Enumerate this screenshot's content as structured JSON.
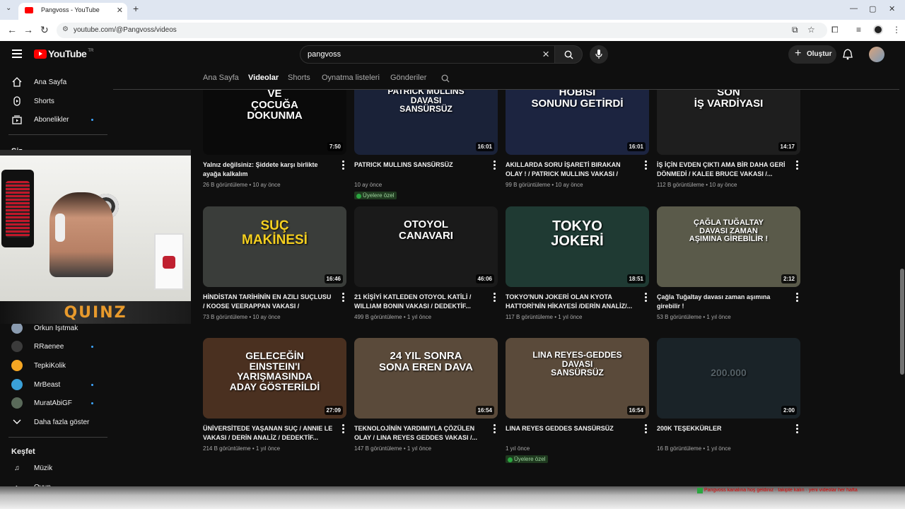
{
  "browser": {
    "tab_title": "Pangvoss - YouTube",
    "tab_close": "✕",
    "new_tab": "+",
    "url": "youtube.com/@Pangvoss/videos"
  },
  "youtube": {
    "logo_text": "YouTube",
    "logo_region": "TR",
    "search_value": "pangvoss",
    "create_label": "Oluştur"
  },
  "sidebar": {
    "top_items": [
      {
        "label": "Ana Sayfa",
        "icon": "home-icon"
      },
      {
        "label": "Shorts",
        "icon": "shorts-icon"
      },
      {
        "label": "Abonelikler",
        "icon": "subscriptions-icon"
      }
    ],
    "you_heading": "Siz",
    "subscriptions": [
      {
        "label": "Orkun Işıtmak",
        "color": "#8a9bb0"
      },
      {
        "label": "RRaenee",
        "color": "#3b3b3b"
      },
      {
        "label": "TepkiKolik",
        "color": "#f5a623"
      },
      {
        "label": "MrBeast",
        "color": "#3aa0d8"
      },
      {
        "label": "MuratAbiGF",
        "color": "#5a6a5a"
      }
    ],
    "show_more": "Daha fazla göster",
    "explore_heading": "Keşfet",
    "explore_items": [
      {
        "label": "Müzik"
      },
      {
        "label": "Oyun"
      }
    ]
  },
  "channel_tabs": [
    "Ana Sayfa",
    "Videolar",
    "Shorts",
    "Oynatma listeleri",
    "Gönderiler"
  ],
  "active_tab": "Videolar",
  "videos": [
    {
      "overlay": "#KADINA\nVE\nÇOCUĞA\nDOKUNMA",
      "duration": "7:50",
      "title": "Yalnız değilsiniz: Şiddete karşı birlikte ayağa kalkalım #kadınaveçocuğadokunma...",
      "views": "26 B görüntüleme",
      "age": "10 ay önce",
      "badge": "",
      "bg": "#0a0a0a",
      "overlay_color": "#ffffff"
    },
    {
      "overlay": "PATRICK MULLINS\nDAVASI\nSANSÜRSÜZ",
      "duration": "16:01",
      "title": "PATRICK MULLINS SANSÜRSÜZ",
      "views": "",
      "age": "10 ay önce",
      "badge": "Üyelere özel",
      "bg": "#1a2238",
      "overlay_color": "#ffffff"
    },
    {
      "overlay": "HOBİSİ\nSONUNU GETİRDİ",
      "duration": "16:01",
      "title": "AKILLARDA SORU İŞARETİ BIRAKAN OLAY ! / PATRICK MULLINS VAKASI / DEDEKTİF...",
      "views": "99 B görüntüleme",
      "age": "10 ay önce",
      "badge": "",
      "bg": "#1c2440",
      "overlay_color": "#ffffff"
    },
    {
      "overlay": "SON\nİŞ VARDİYASI",
      "duration": "14:17",
      "title": "İŞ İÇİN EVDEN ÇIKTI AMA BİR DAHA GERİ DÖNMEDİ / KALEE BRUCE VAKASI /...",
      "views": "112 B görüntüleme",
      "age": "10 ay önce",
      "badge": "",
      "bg": "#1e1e1e",
      "overlay_color": "#ffffff"
    },
    {
      "overlay": "SUÇ\nMAKİNESİ",
      "duration": "16:46",
      "title": "HİNDİSTAN TARİHİNİN EN AZILI SUÇLUSU / KOOSE VEERAPPAN VAKASI / DEDEKTİF...",
      "views": "73 B görüntüleme",
      "age": "10 ay önce",
      "badge": "",
      "bg": "#3a3d3a",
      "overlay_color": "#f5d020"
    },
    {
      "overlay": "OTOYOL\nCANAVARI",
      "duration": "46:06",
      "title": "21 KİŞİYİ KATLEDEN OTOYOL KATİLİ / WILLIAM BONIN VAKASI / DEDEKTİF...",
      "views": "499 B görüntüleme",
      "age": "1 yıl önce",
      "badge": "",
      "bg": "#1a1a1a",
      "overlay_color": "#ffffff"
    },
    {
      "overlay": "TOKYO\nJOKERİ",
      "duration": "18:51",
      "title": "TOKYO'NUN JOKERİ OLAN KYOTA HATTORİ'NİN HİKAYESİ /DERİN ANALİZ/...",
      "views": "117 B görüntüleme",
      "age": "1 yıl önce",
      "badge": "",
      "bg": "#1f3a33",
      "overlay_color": "#ffffff"
    },
    {
      "overlay": "ÇAĞLA TUĞALTAY\nDAVASI ZAMAN\nAŞIMINA GİREBİLİR !",
      "duration": "2:12",
      "title": "Çağla Tuğaltay davası zaman aşımına girebilir !",
      "views": "53 B görüntüleme",
      "age": "1 yıl önce",
      "badge": "",
      "bg": "#5a5a4a",
      "overlay_color": "#ffffff"
    },
    {
      "overlay": "GELECEĞİN\nEINSTEIN'I\nYARIŞMASINDA\nADAY GÖSTERİLDİ",
      "duration": "27:09",
      "title": "ÜNİVERSİTEDE YAŞANAN SUÇ / ANNIE LE VAKASI / DERİN ANALİZ / DEDEKTİF...",
      "views": "214 B görüntüleme",
      "age": "1 yıl önce",
      "badge": "",
      "bg": "#4a3020",
      "overlay_color": "#ffffff"
    },
    {
      "overlay": "24 YIL SONRA\nSONA EREN DAVA",
      "duration": "16:54",
      "title": "TEKNOLOJİNİN YARDIMIYLA ÇÖZÜLEN OLAY / LINA REYES GEDDES VAKASI /...",
      "views": "147 B görüntüleme",
      "age": "1 yıl önce",
      "badge": "",
      "bg": "#5a4a3a",
      "overlay_color": "#ffffff"
    },
    {
      "overlay": "LINA REYES-GEDDES\nDAVASI\nSANSÜRSÜZ",
      "duration": "16:54",
      "title": "LINA REYES GEDDES SANSÜRSÜZ",
      "views": "",
      "age": "1 yıl önce",
      "badge": "Üyelere özel",
      "bg": "#5a4a3a",
      "overlay_color": "#ffffff"
    },
    {
      "overlay": "200.000",
      "duration": "2:00",
      "title": "200K TEŞEKKÜRLER",
      "views": "16 B görüntüleme",
      "age": "1 yıl önce",
      "badge": "",
      "bg": "#1a2328",
      "overlay_color": "#556066"
    }
  ],
  "webcam": {
    "overlay_text": "QUINZ"
  },
  "ticker": "Pangvoss kanalına hoş geldiniz · takipte kalın · yeni videolar her hafta"
}
